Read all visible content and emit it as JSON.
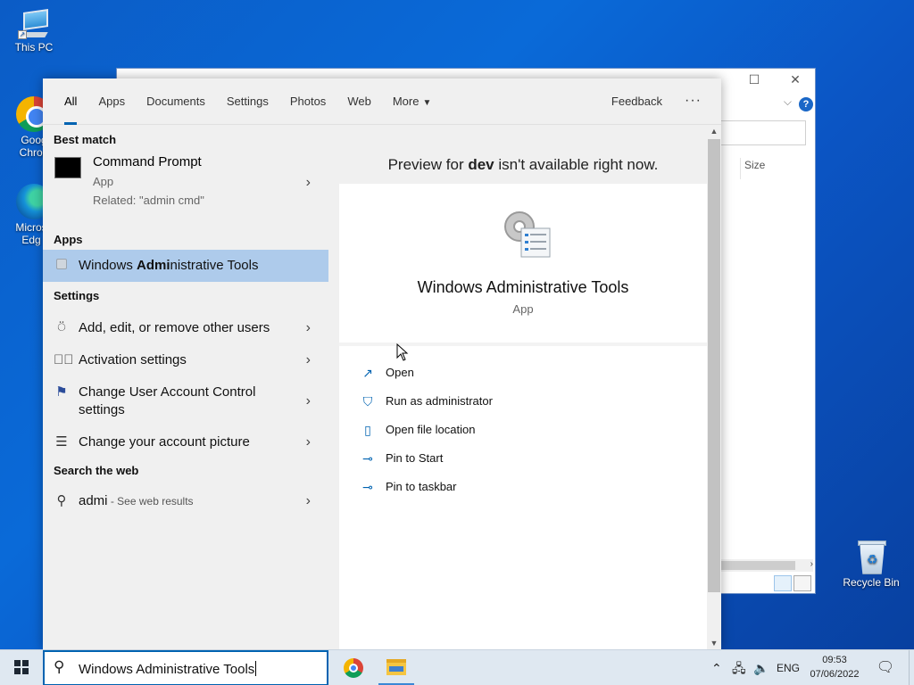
{
  "desktop": {
    "icons": [
      {
        "label": "This PC"
      },
      {
        "label": "Goog Chron"
      },
      {
        "label": "Micros Edg"
      },
      {
        "label": "Recycle Bin"
      }
    ]
  },
  "explorer_window": {
    "size_column": "Size",
    "help": "?"
  },
  "search": {
    "tabs": [
      "All",
      "Apps",
      "Documents",
      "Settings",
      "Photos",
      "Web",
      "More"
    ],
    "active_tab": "All",
    "feedback": "Feedback",
    "more_options": "···",
    "best_match": {
      "header": "Best match",
      "title": "Command Prompt",
      "type": "App",
      "related": "Related: \"admin cmd\""
    },
    "apps": {
      "header": "Apps",
      "items": [
        {
          "pre": "Windows ",
          "bold": "Admi",
          "post": "nistrative Tools"
        }
      ]
    },
    "settings": {
      "header": "Settings",
      "items": [
        {
          "label": "Add, edit, or remove other users",
          "icon": "person-add-icon"
        },
        {
          "label": "Activation settings",
          "icon": "check-circle-icon"
        },
        {
          "label": "Change User Account Control settings",
          "icon": "flag-icon"
        },
        {
          "label": "Change your account picture",
          "icon": "account-list-icon"
        }
      ]
    },
    "web": {
      "header": "Search the web",
      "query": "admi",
      "hint": " - See web results"
    },
    "preview": {
      "message_pre": "Preview for ",
      "message_bold": "dev",
      "message_post": " isn't available right now.",
      "app_title": "Windows Administrative Tools",
      "app_type": "App",
      "actions": [
        "Open",
        "Run as administrator",
        "Open file location",
        "Pin to Start",
        "Pin to taskbar"
      ]
    },
    "query": "Windows Administrative Tools"
  },
  "taskbar": {
    "language": "ENG",
    "time": "09:53",
    "date": "07/06/2022"
  },
  "colors": {
    "accent": "#0063b1",
    "selection": "#aecbeb"
  }
}
